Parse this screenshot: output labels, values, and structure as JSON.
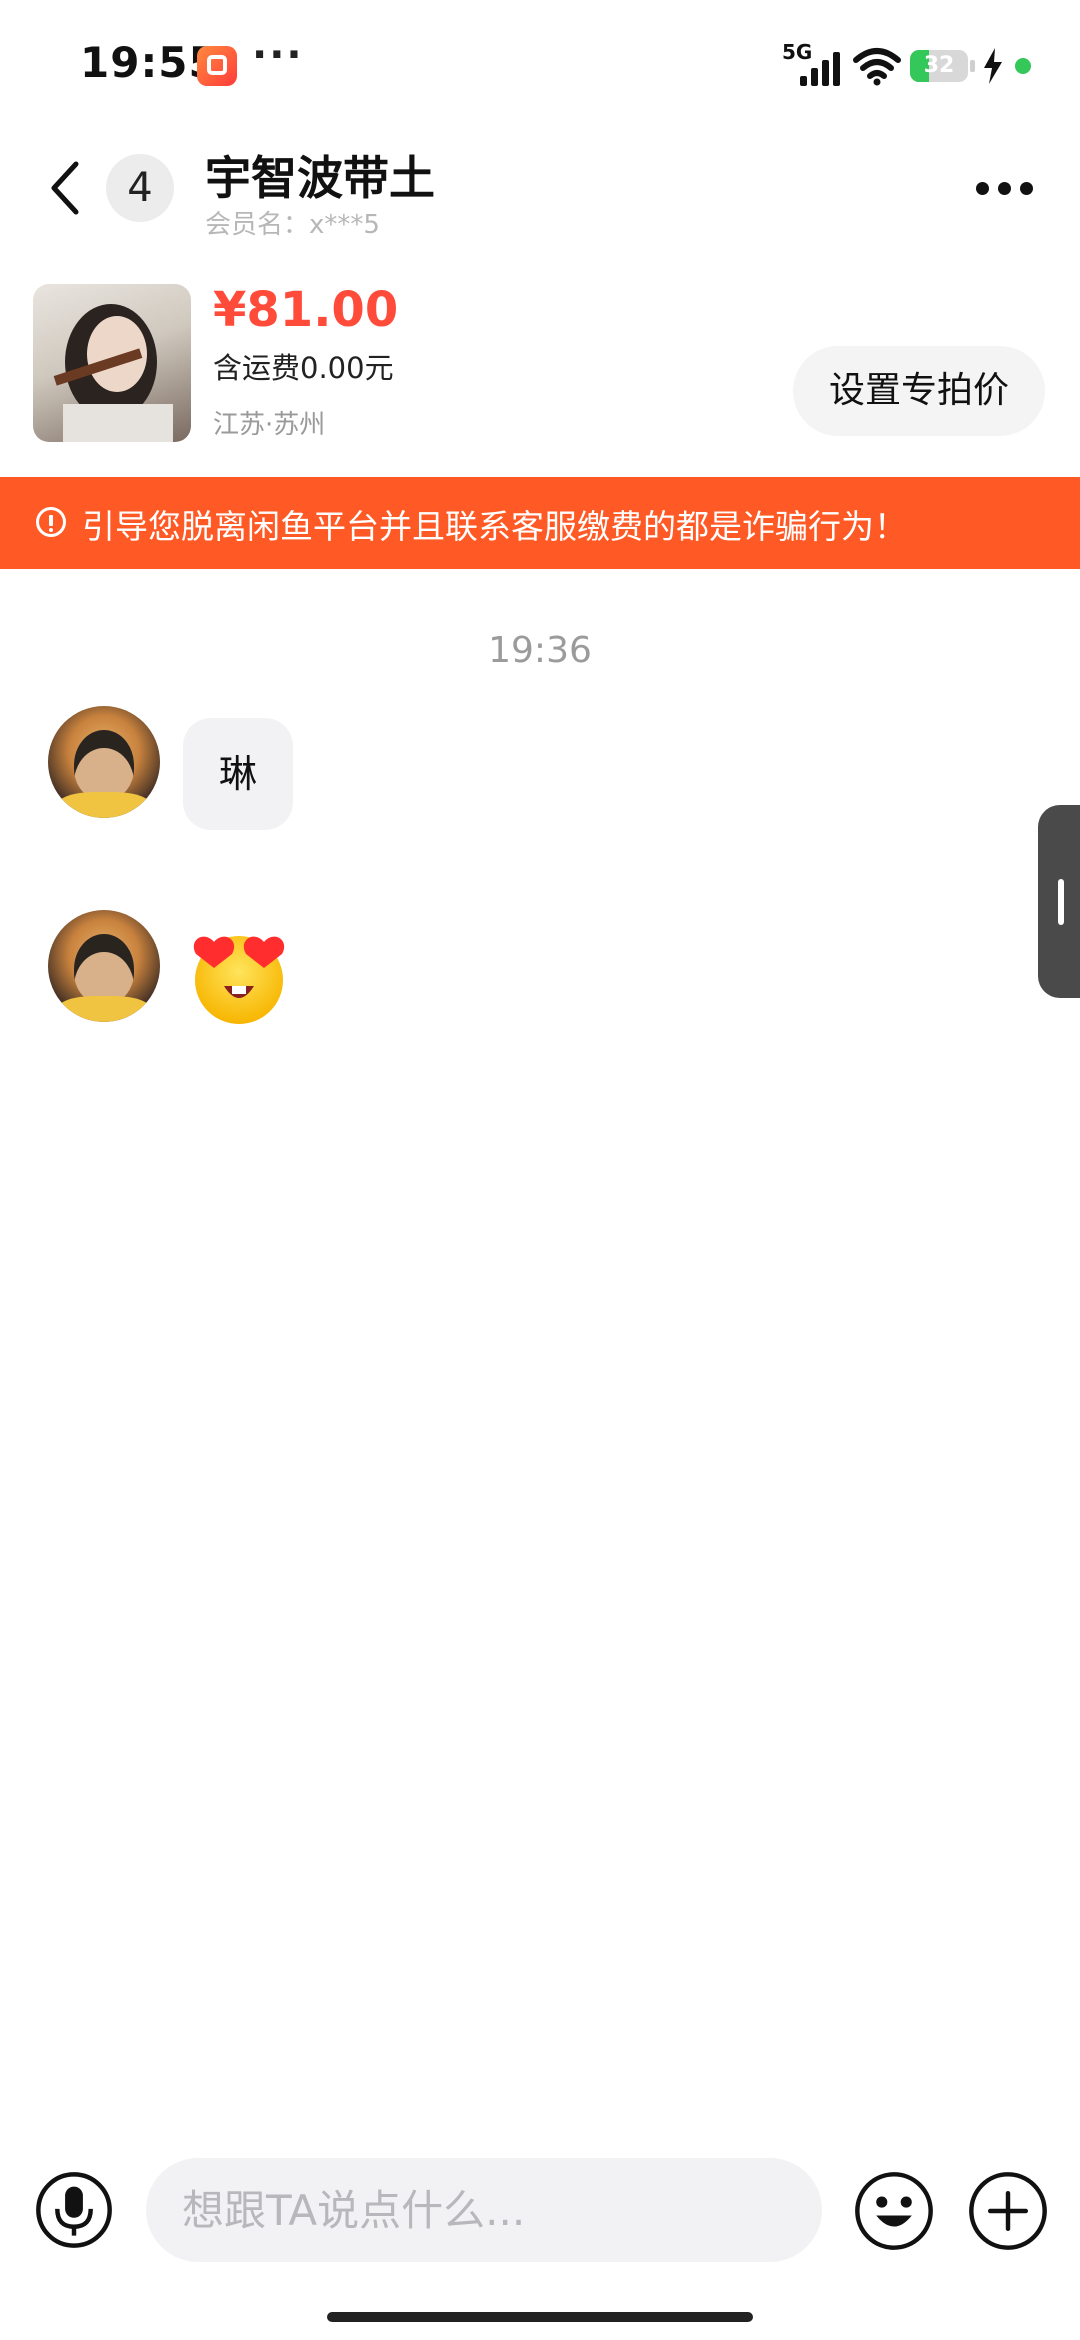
{
  "status_bar": {
    "time": "19:55",
    "more_indicator": "···",
    "network": "5G",
    "battery_level": "32",
    "battery_fraction": 0.32,
    "app_notification_icon": "xianyu-app-icon"
  },
  "header": {
    "back_icon": "chevron-left-icon",
    "unread_count": "4",
    "title": "宇智波带土",
    "member_name": "会员名：x***5",
    "more_icon": "more-horizontal-icon"
  },
  "product": {
    "price": "¥81.00",
    "shipping": "含运费0.00元",
    "location": "江苏·苏州",
    "action_label": "设置专拍价"
  },
  "warning": {
    "icon": "alert-circle-icon",
    "text": "引导您脱离闲鱼平台并且联系客服缴费的都是诈骗行为！"
  },
  "messages": {
    "timestamp": "19:36",
    "items": [
      {
        "type": "text",
        "text": "琳"
      },
      {
        "type": "sticker",
        "icon": "heart-eyes-emoji"
      }
    ]
  },
  "composer": {
    "placeholder": "想跟TA说点什么...",
    "mic_icon": "microphone-icon",
    "emoji_icon": "smiley-icon",
    "plus_icon": "plus-icon"
  },
  "colors": {
    "accent_price": "#ff4b3a",
    "warning_bg": "#ff5a26",
    "bubble_bg": "#f2f2f4"
  }
}
